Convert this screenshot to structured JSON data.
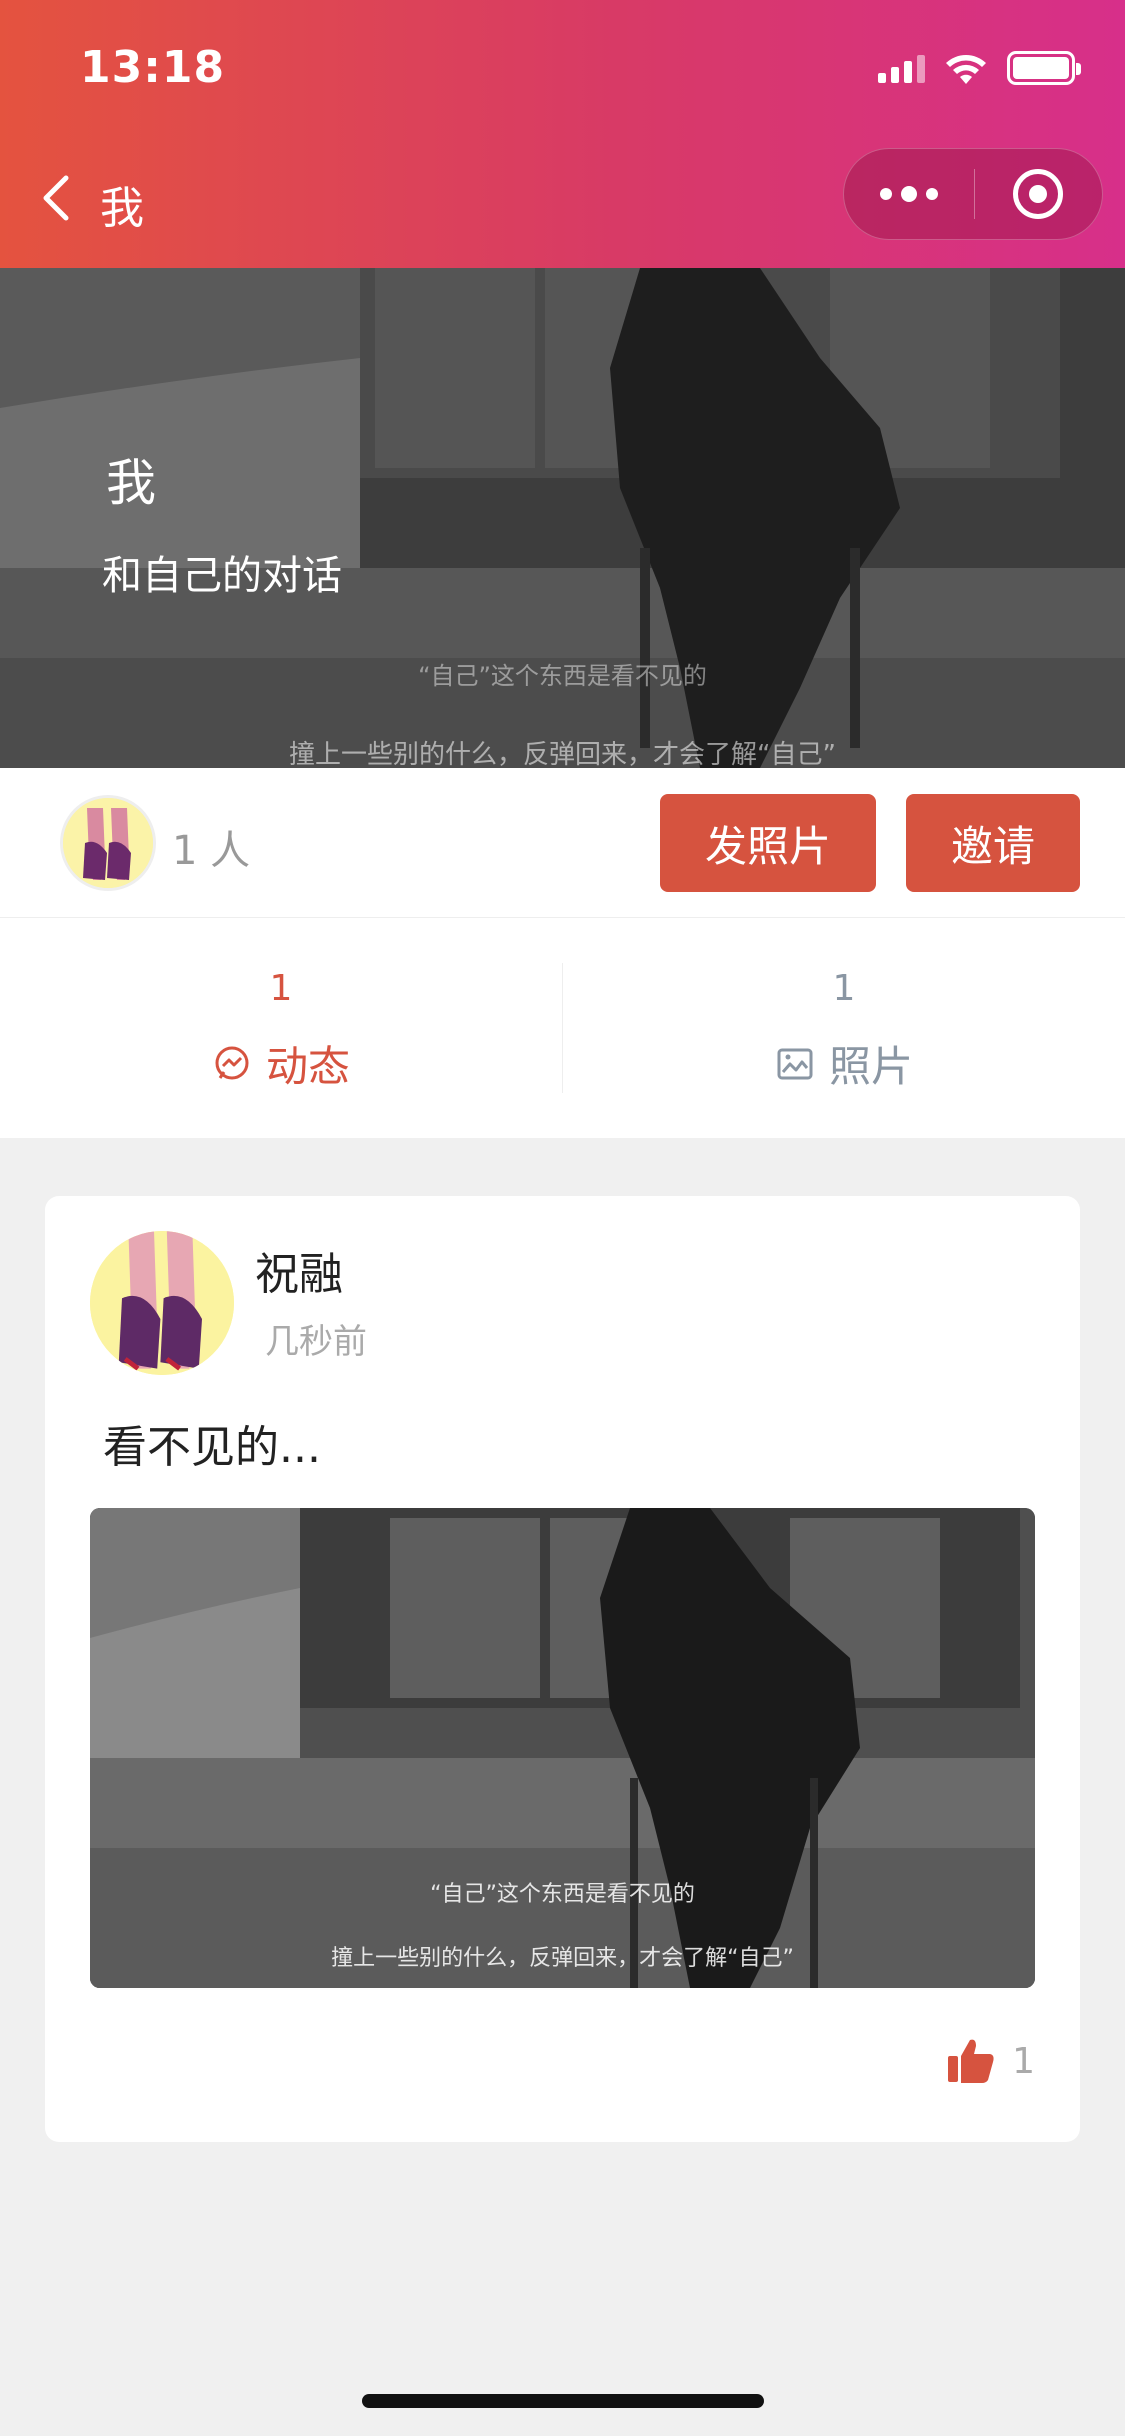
{
  "status_bar": {
    "time": "13:18"
  },
  "nav": {
    "title": "我"
  },
  "banner": {
    "title": "我",
    "subtitle": "和自己的对话",
    "caption_line1": "“自己”这个东西是看不见的",
    "caption_line2": "撞上一些别的什么，反弹回来，才会了解“自己”"
  },
  "members": {
    "count_label": "1 人"
  },
  "actions": {
    "post_photo": "发照片",
    "invite": "邀请"
  },
  "tabs": [
    {
      "count": "1",
      "label": "动态",
      "icon": "activity-icon",
      "active": true
    },
    {
      "count": "1",
      "label": "照片",
      "icon": "image-icon",
      "active": false
    }
  ],
  "post": {
    "author": "祝融",
    "time": "几秒前",
    "text": "看不见的...",
    "photo_caption_line1": "“自己”这个东西是看不见的",
    "photo_caption_line2": "撞上一些别的什么，反弹回来，才会了解“自己”",
    "likes": "1"
  },
  "colors": {
    "accent": "#d6533f",
    "gradient_start": "#e4533f",
    "gradient_end": "#d72f8a",
    "muted": "#8a96a3"
  }
}
